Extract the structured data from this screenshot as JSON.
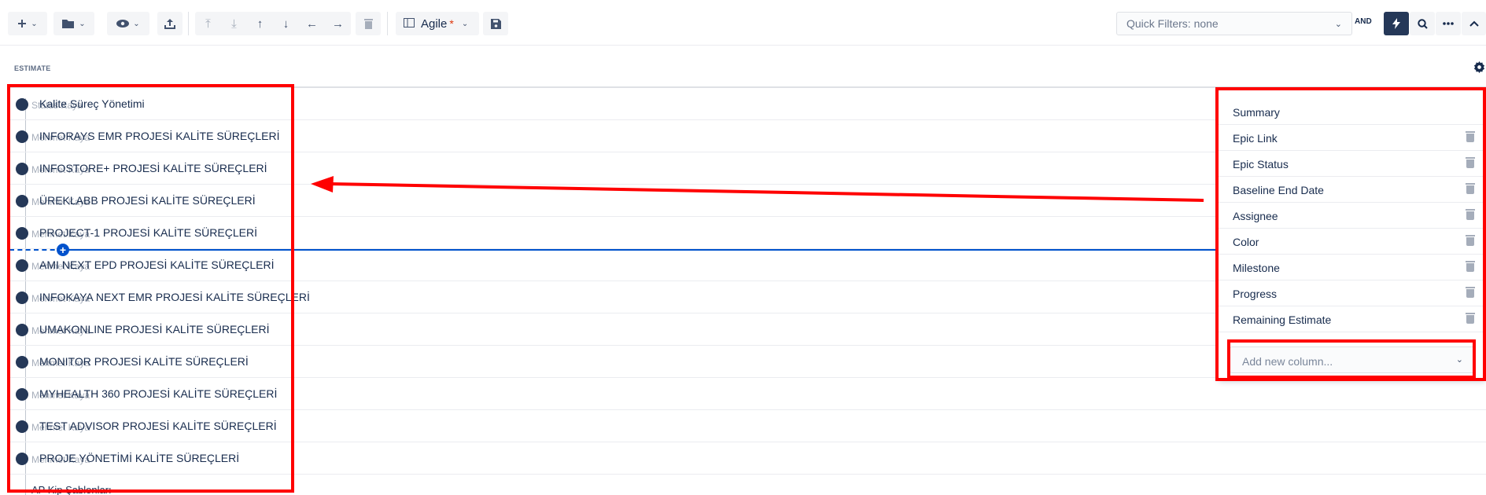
{
  "toolbar": {
    "add_icon": "plus-icon",
    "folder_icon": "folder-icon",
    "view_icon": "eye-icon",
    "export_icon": "upload-icon",
    "move_icons": [
      "move-top-icon",
      "move-bottom-icon",
      "move-up-icon",
      "move-down-icon",
      "outdent-icon",
      "indent-icon"
    ],
    "delete_icon": "trash-icon",
    "view_name": "Agile",
    "unsaved_marker": "*",
    "save_icon": "save-icon"
  },
  "quick_filters": {
    "placeholder": "Quick Filters: none",
    "operator": "AND"
  },
  "right_tools": [
    "lightning-icon",
    "search-icon",
    "more-icon",
    "collapse-icon"
  ],
  "table": {
    "header_text": "ESTIMATE",
    "settings_icon": "gear-icon"
  },
  "rows": [
    {
      "label": "Kalite Süreç Yönetimi",
      "ghost": "Status Kaya"
    },
    {
      "label": "INFORAYS EMR PROJESİ KALİTE SÜREÇLERİ",
      "ghost": "Mehmet Kaya"
    },
    {
      "label": "INFOSTORE+ PROJESİ KALİTE SÜREÇLERİ",
      "ghost": "Mehmet Kaya"
    },
    {
      "label": "ÜREKLABB PROJESİ KALİTE SÜREÇLERİ",
      "ghost": "Mehmet Kaya"
    },
    {
      "label": "PROJECT-1 PROJESİ KALİTE SÜREÇLERİ",
      "ghost": "Mehmet Kaya"
    },
    {
      "label": "AMI NEXT EPD PROJESİ KALİTE SÜREÇLERİ",
      "ghost": "Mehmet Kaya"
    },
    {
      "label": "INFOKAYA NEXT EMR PROJESİ KALİTE SÜREÇLERİ",
      "ghost": "Mehmet Kaya"
    },
    {
      "label": "UMAKONLINE PROJESİ KALİTE SÜREÇLERİ",
      "ghost": "Mehmet Kaya"
    },
    {
      "label": "MONITOR PROJESİ KALİTE SÜREÇLERİ",
      "ghost": "Mehmet Kaya"
    },
    {
      "label": "MYHEALTH 360 PROJESİ KALİTE SÜREÇLERİ",
      "ghost": "Mehmet Kaya"
    },
    {
      "label": "TEST ADVISOR PROJESİ KALİTE SÜREÇLERİ",
      "ghost": "Mehmet Kaya"
    },
    {
      "label": "PROJE YÖNETİMİ KALİTE SÜREÇLERİ",
      "ghost": "Mehmet Kaya"
    }
  ],
  "last_row": "AP Kip Şablonları",
  "column_panel": {
    "columns": [
      "Summary",
      "Epic Link",
      "Epic Status",
      "Baseline End Date",
      "Assignee",
      "Color",
      "Milestone",
      "Progress",
      "Remaining Estimate"
    ],
    "add_placeholder": "Add new column..."
  },
  "annotation_color": "#ff0000"
}
